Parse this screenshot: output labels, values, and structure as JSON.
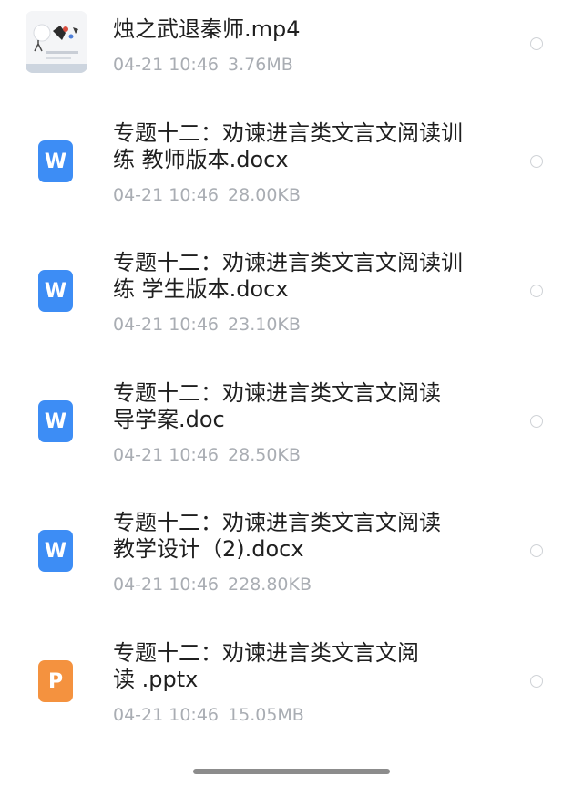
{
  "files": [
    {
      "icon": "video-thumbnail",
      "name": "烛之武退秦师.mp4",
      "date": "04-21 10:46",
      "size": "3.76MB"
    },
    {
      "icon": "word-doc-icon",
      "icon_letter": "W",
      "name": "专题十二：劝谏进言类文言文阅读训\n练 教师版本.docx",
      "date": "04-21 10:46",
      "size": "28.00KB"
    },
    {
      "icon": "word-doc-icon",
      "icon_letter": "W",
      "name": "专题十二：劝谏进言类文言文阅读训\n练 学生版本.docx",
      "date": "04-21 10:46",
      "size": "23.10KB"
    },
    {
      "icon": "word-doc-icon",
      "icon_letter": "W",
      "name": "专题十二：劝谏进言类文言文阅读\n导学案.doc",
      "date": "04-21 10:46",
      "size": "28.50KB"
    },
    {
      "icon": "word-doc-icon",
      "icon_letter": "W",
      "name": "专题十二：劝谏进言类文言文阅读\n教学设计（2).docx",
      "date": "04-21 10:46",
      "size": "228.80KB"
    },
    {
      "icon": "ppt-doc-icon",
      "icon_letter": "P",
      "name": "专题十二：劝谏进言类文言文阅\n读 .pptx",
      "date": "04-21 10:46",
      "size": "15.05MB"
    }
  ],
  "colors": {
    "word_icon": "#3d8df5",
    "ppt_icon": "#f4923f",
    "filename_text": "#1f1f1f",
    "meta_text": "#a9adb3",
    "radio_border": "#cfd2d6"
  }
}
